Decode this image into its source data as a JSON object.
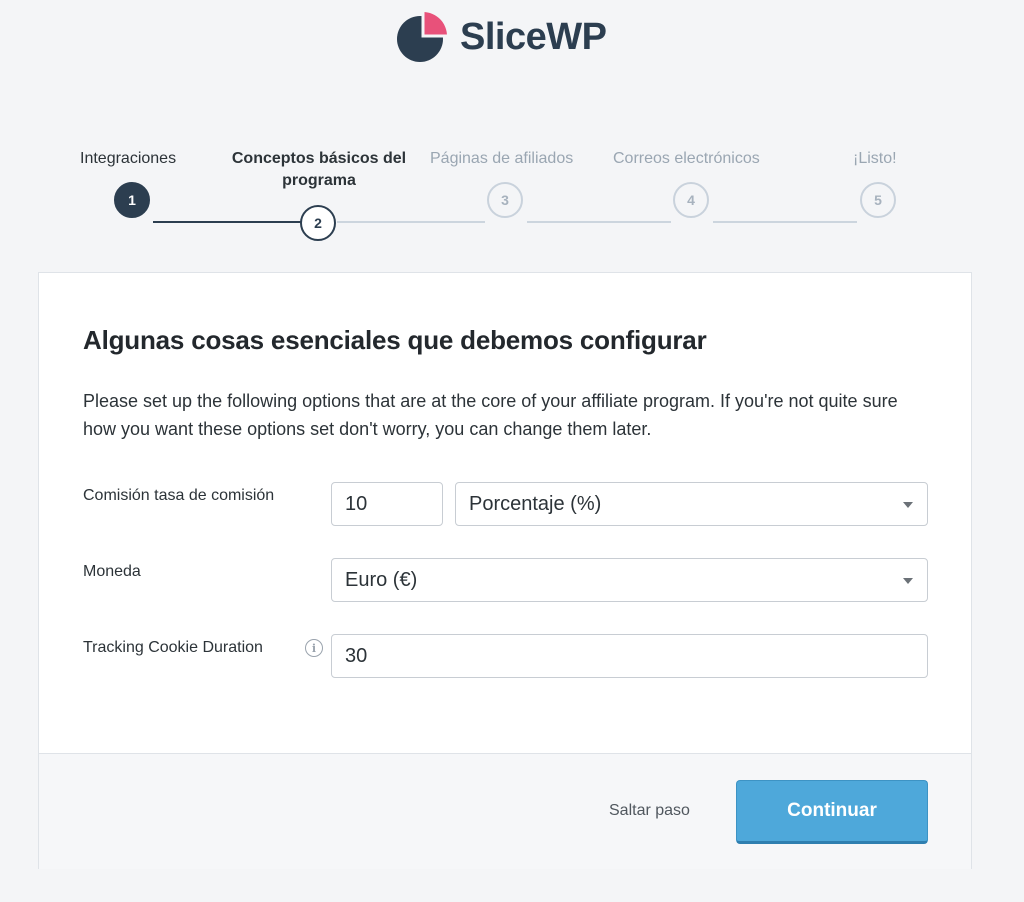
{
  "brand": {
    "name": "SliceWP",
    "colors": {
      "dark": "#2c3e50",
      "accent": "#e8517a"
    }
  },
  "wizard": {
    "steps": [
      {
        "label": "Integraciones",
        "number": "1",
        "state": "done"
      },
      {
        "label": "Conceptos básicos del programa",
        "number": "2",
        "state": "active"
      },
      {
        "label": "Páginas de afiliados",
        "number": "3",
        "state": "pending"
      },
      {
        "label": "Correos electrónicos",
        "number": "4",
        "state": "pending"
      },
      {
        "label": "¡Listo!",
        "number": "5",
        "state": "pending"
      }
    ]
  },
  "card": {
    "title": "Algunas cosas esenciales que debemos configurar",
    "description": "Please set up the following options that are at the core of your affiliate program. If you're not quite sure how you want these options set don't worry, you can change them later.",
    "fields": {
      "commission": {
        "label": "Comisión tasa de comisión",
        "rate_value": "10",
        "type_value": "Porcentaje (%)"
      },
      "currency": {
        "label": "Moneda",
        "value": "Euro (€)"
      },
      "cookie": {
        "label": "Tracking Cookie Duration",
        "value": "30",
        "info_icon": "info-icon"
      }
    },
    "footer": {
      "skip_label": "Saltar paso",
      "continue_label": "Continuar",
      "continue_color": "#4ea8da"
    }
  }
}
